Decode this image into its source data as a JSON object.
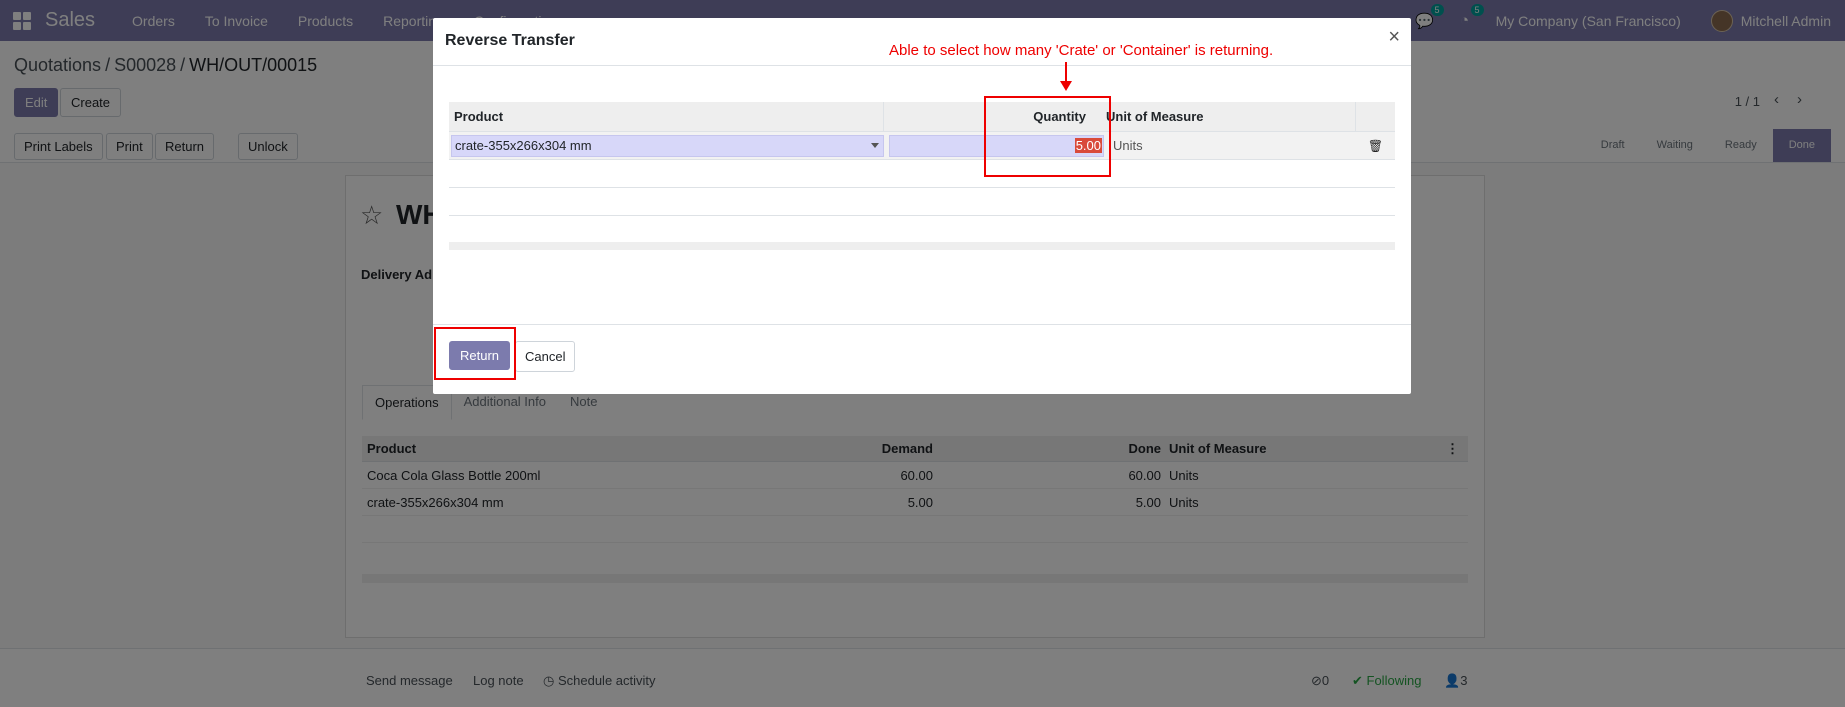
{
  "topbar": {
    "brand": "Sales",
    "menu": [
      "Orders",
      "To Invoice",
      "Products",
      "Reporting",
      "Configuration"
    ],
    "messages_count": "5",
    "activities_count": "5",
    "company": "My Company (San Francisco)",
    "user": "Mitchell Admin",
    "accent_color": "#7c7bad"
  },
  "breadcrumb": {
    "items": [
      "Quotations",
      "S00028",
      "WH/OUT/00015"
    ]
  },
  "control": {
    "edit_label": "Edit",
    "create_label": "Create",
    "pager": "1 / 1"
  },
  "header_buttons": [
    "Print Labels",
    "Print",
    "Return",
    "Unlock"
  ],
  "status_stages": [
    "Draft",
    "Waiting",
    "Ready",
    "Done"
  ],
  "record": {
    "title": "WH",
    "delivery_label": "Delivery Ad"
  },
  "tabs": [
    "Operations",
    "Additional Info",
    "Note"
  ],
  "operations": {
    "headers": [
      "Product",
      "Demand",
      "Done",
      "Unit of Measure"
    ],
    "rows": [
      {
        "product": "Coca Cola Glass Bottle 200ml",
        "demand": "60.00",
        "done": "60.00",
        "uom": "Units"
      },
      {
        "product": "crate-355x266x304 mm",
        "demand": "5.00",
        "done": "5.00",
        "uom": "Units"
      }
    ]
  },
  "chatter": {
    "send_message": "Send message",
    "log_note": "Log note",
    "schedule_activity": "Schedule activity",
    "attachments": "0",
    "following": "Following",
    "followers": "3"
  },
  "modal": {
    "title": "Reverse Transfer",
    "annotation": "Able to select how many 'Crate' or 'Container' is returning.",
    "headers": [
      "Product",
      "Quantity",
      "Unit of Measure"
    ],
    "row": {
      "product": "crate-355x266x304 mm",
      "quantity": "5.00",
      "uom": "Units"
    },
    "return_label": "Return",
    "cancel_label": "Cancel"
  }
}
